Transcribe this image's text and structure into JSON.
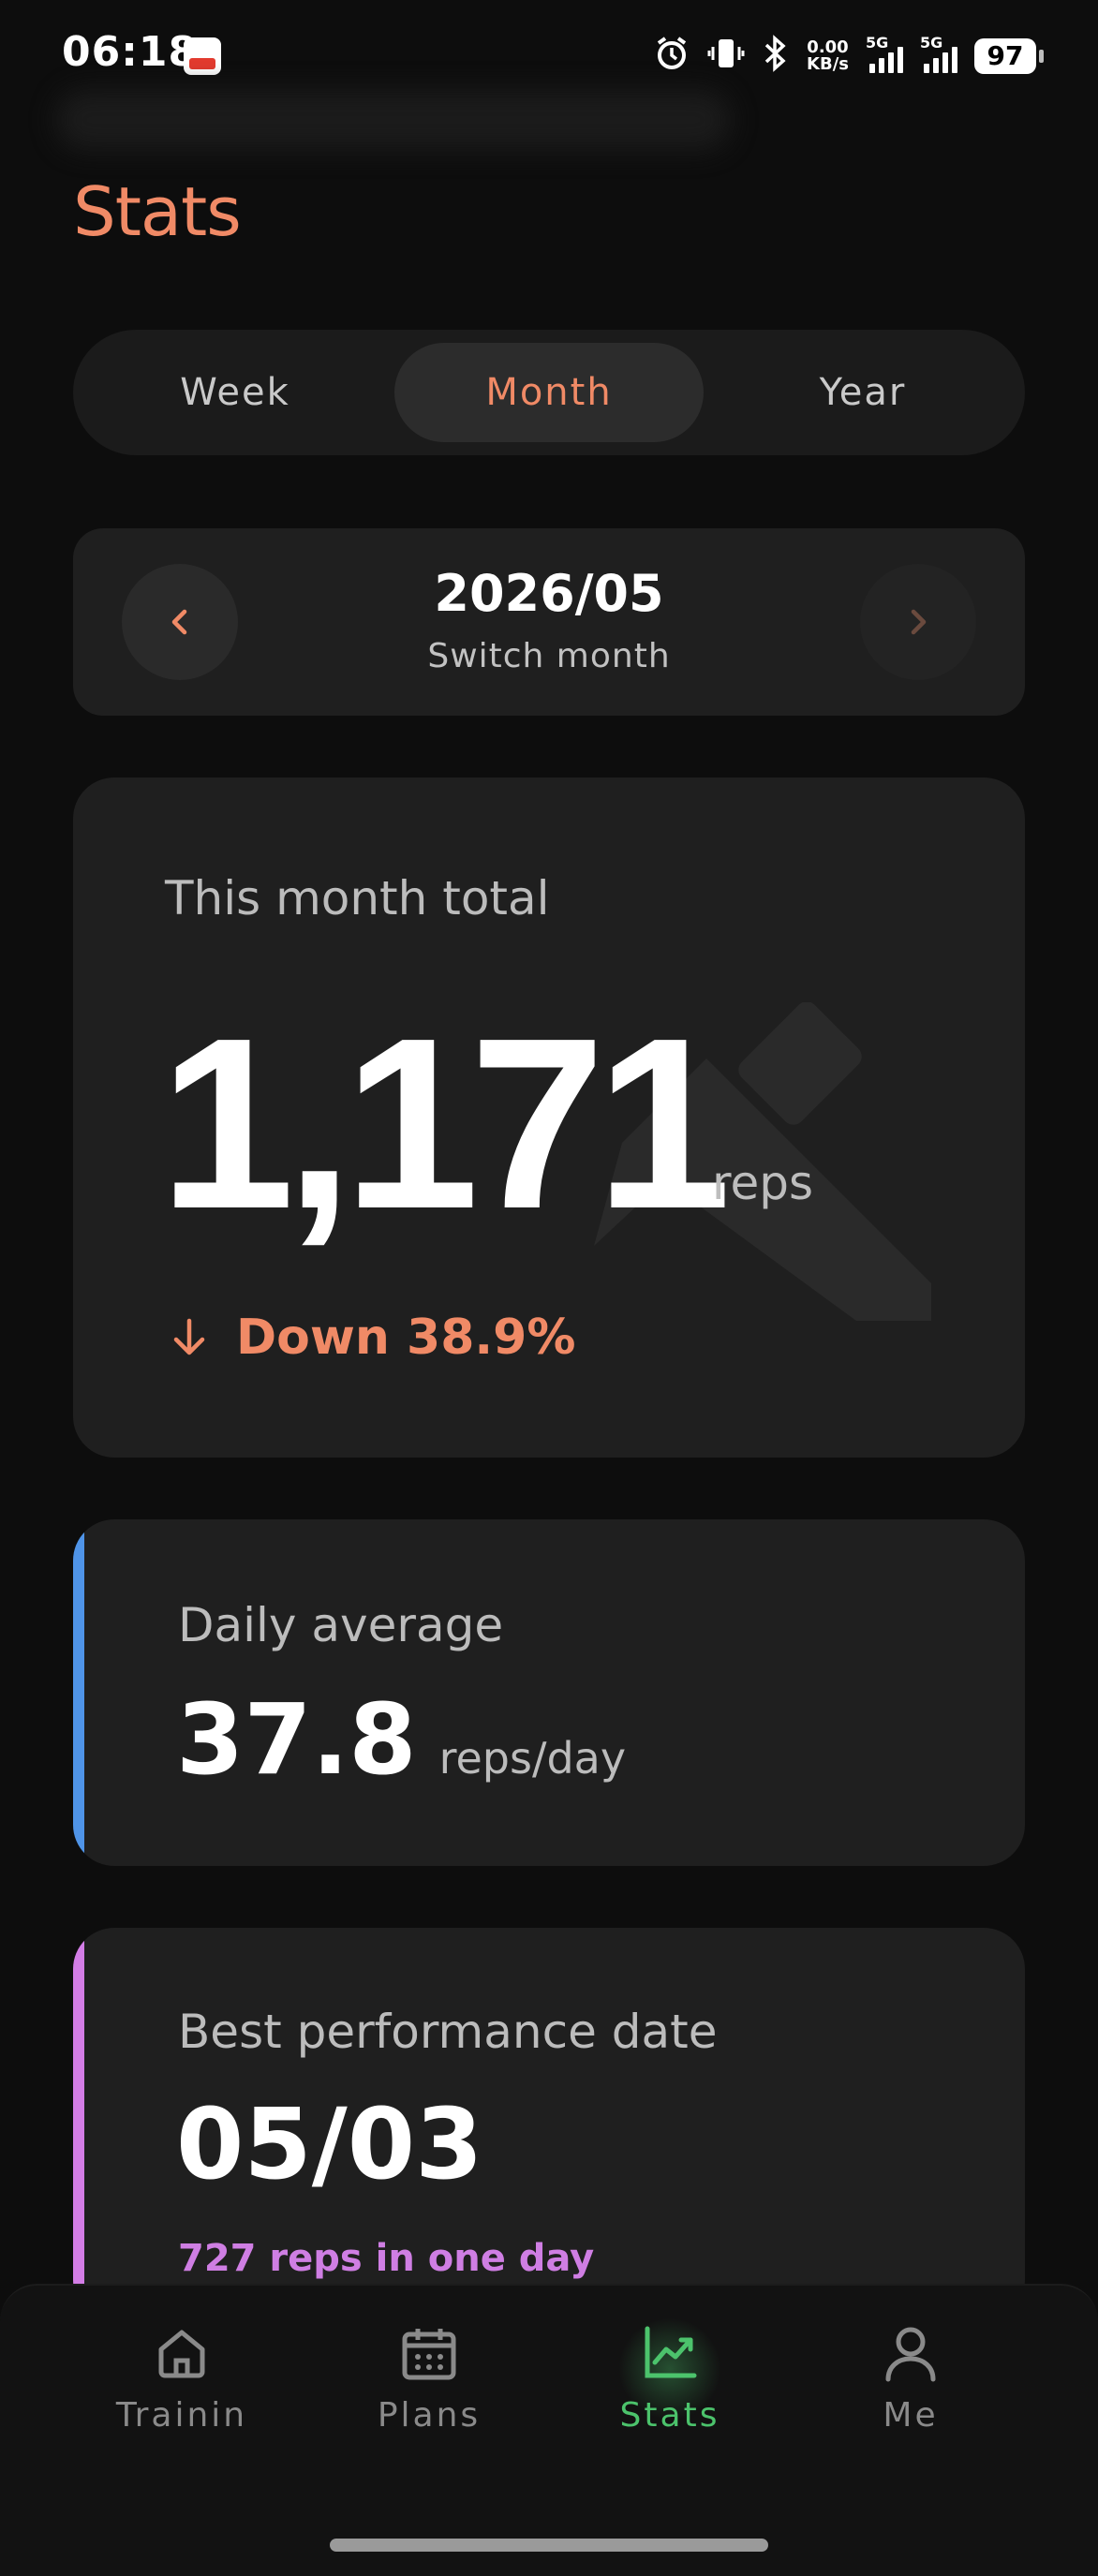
{
  "status_bar": {
    "time": "06:18",
    "net_speed": "0.00",
    "net_unit": "KB/s",
    "sim1_label": "5G",
    "sim2_label": "5G",
    "battery": "97"
  },
  "header": {
    "title": "Stats"
  },
  "period_tabs": [
    {
      "label": "Week",
      "active": false
    },
    {
      "label": "Month",
      "active": true
    },
    {
      "label": "Year",
      "active": false
    }
  ],
  "month_switcher": {
    "current": "2026/05",
    "subtitle": "Switch month"
  },
  "total_card": {
    "label": "This month total",
    "value": "1,171",
    "unit": "reps",
    "trend_text": "Down 38.9%",
    "trend_direction": "down"
  },
  "daily_average_card": {
    "label": "Daily average",
    "value": "37.8",
    "unit": "reps/day",
    "accent": "#4f94e8"
  },
  "best_date_card": {
    "label": "Best performance date",
    "value": "05/03",
    "note": "727 reps in one day",
    "accent": "#d37de6"
  },
  "bottom_nav": [
    {
      "label": "Trainin",
      "icon": "home-icon",
      "active": false
    },
    {
      "label": "Plans",
      "icon": "calendar-icon",
      "active": false
    },
    {
      "label": "Stats",
      "icon": "chart-icon",
      "active": true
    },
    {
      "label": "Me",
      "icon": "person-icon",
      "active": false
    }
  ],
  "colors": {
    "accent": "#f08a66",
    "active_nav": "#4cc36c",
    "background": "#0d0d0d",
    "card": "#1f1f1f"
  }
}
